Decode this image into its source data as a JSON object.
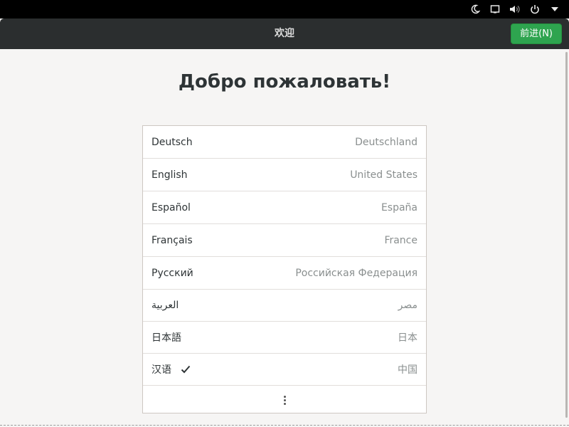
{
  "system_tray": {
    "icons": [
      "night-mode-icon",
      "display-icon",
      "volume-icon",
      "power-icon",
      "tray-menu-arrow-icon"
    ]
  },
  "header": {
    "title": "欢迎",
    "next_button": "前进(N)"
  },
  "main": {
    "heading": "Добро пожаловать!",
    "languages": [
      {
        "language": "Deutsch",
        "region": "Deutschland",
        "selected": false
      },
      {
        "language": "English",
        "region": "United States",
        "selected": false
      },
      {
        "language": "Español",
        "region": "España",
        "selected": false
      },
      {
        "language": "Français",
        "region": "France",
        "selected": false
      },
      {
        "language": "Русский",
        "region": "Российская Федерация",
        "selected": false
      },
      {
        "language": "العربية",
        "region": "مصر",
        "selected": false
      },
      {
        "language": "日本語",
        "region": "日本",
        "selected": false
      },
      {
        "language": "汉语",
        "region": "中国",
        "selected": true
      }
    ],
    "more_icon": "more-vertical-icon"
  },
  "colors": {
    "accent_button": "#2ea44f",
    "headerbar": "#2b2e2f",
    "background": "#f6f5f4"
  }
}
